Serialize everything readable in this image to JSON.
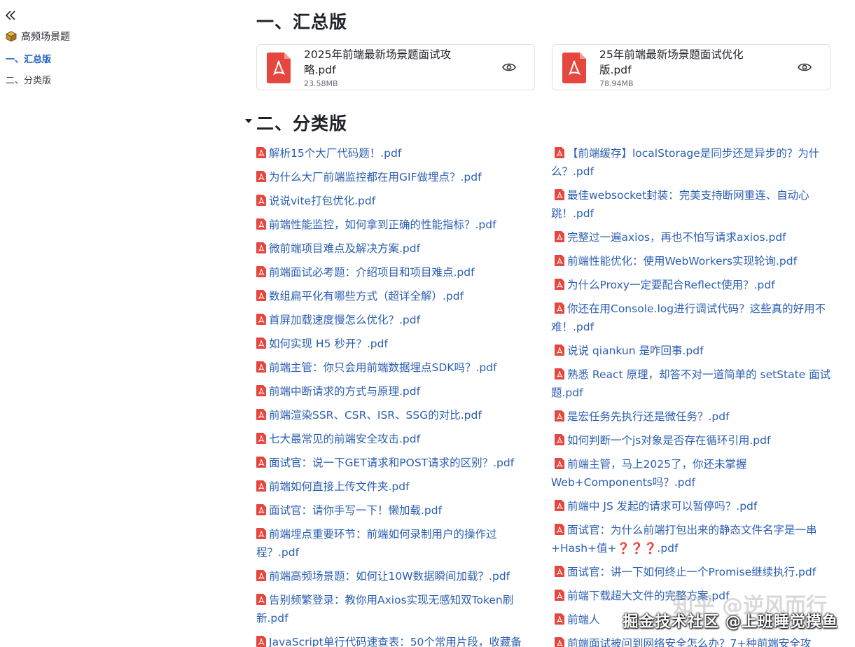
{
  "sidebar": {
    "title": "高频场景题",
    "items": [
      {
        "label": "一、汇总版",
        "active": true
      },
      {
        "label": "二、分类版",
        "active": false
      }
    ]
  },
  "sections": {
    "summary_title": "一、汇总版",
    "category_title": "二、分类版"
  },
  "files": [
    {
      "name": "2025年前端最新场景题面试攻略.pdf",
      "size": "23.58MB"
    },
    {
      "name": "25年前端最新场景题面试优化版.pdf",
      "size": "78.94MB"
    }
  ],
  "links_left": [
    "解析15个大厂代码题！.pdf",
    "为什么大厂前端监控都在用GIF做埋点？.pdf",
    "说说vite打包优化.pdf",
    "前端性能监控，如何拿到正确的性能指标？.pdf",
    "微前端项目难点及解决方案.pdf",
    "前端面试必考题：介绍项目和项目难点.pdf",
    "数组扁平化有哪些方式（超详全解）.pdf",
    "首屏加载速度慢怎么优化？.pdf",
    "如何实现 H5 秒开？.pdf",
    "前端主管：你只会用前端数据埋点SDK吗？.pdf",
    "前端中断请求的方式与原理.pdf",
    "前端渲染SSR、CSR、ISR、SSG的对比.pdf",
    "七大最常见的前端安全攻击.pdf",
    "面试官：说一下GET请求和POST请求的区别？.pdf",
    "前端如何直接上传文件夹.pdf",
    "面试官：请你手写一下！懒加载.pdf",
    "前端埋点重要环节：前端如何录制用户的操作过程？.pdf",
    "前端高频场景题：如何让10W数据瞬间加载？.pdf",
    "告别频繁登录：教你用Axios实现无感知双Token刷新.pdf",
    "JavaScript单行代码速查表：50个常用片段，收藏备"
  ],
  "links_right": [
    "【前端缓存】localStorage是同步还是异步的？为什么？.pdf",
    "最佳websocket封装：完美支持断网重连、自动心跳！.pdf",
    "完整过一遍axios，再也不怕写请求axios.pdf",
    "前端性能优化：使用WebWorkers实现轮询.pdf",
    "为什么Proxy一定要配合Reflect使用？.pdf",
    "你还在用Console.log进行调试代码？这些真的好用不难！.pdf",
    "说说 qiankun 是咋回事.pdf",
    "熟悉 React 原理，却答不对一道简单的 setState 面试题.pdf",
    "是宏任务先执行还是微任务？.pdf",
    "如何判断一个js对象是否存在循环引用.pdf",
    "前端主管，马上2025了，你还未掌握Web+Components吗？.pdf",
    "前端中 JS 发起的请求可以暂停吗？.pdf",
    "面试官：为什么前端打包出来的静态文件名字是一串+Hash+值+❓❓❓.pdf",
    "面试官：讲一下如何终止一个Promise继续执行.pdf",
    "前端下载超大文件的完整方案.pdf",
    "前端人",
    "前端面试被问到网络安全怎么办？7+种前端安全攻"
  ],
  "watermark": {
    "bg": "知乎 @逆风而行",
    "fg": "掘金技术社区 @上班睡觉摸鱼"
  },
  "colors": {
    "link": "#2c5fb0",
    "pdf": "#e5473f",
    "active": "#1f5fbf"
  }
}
